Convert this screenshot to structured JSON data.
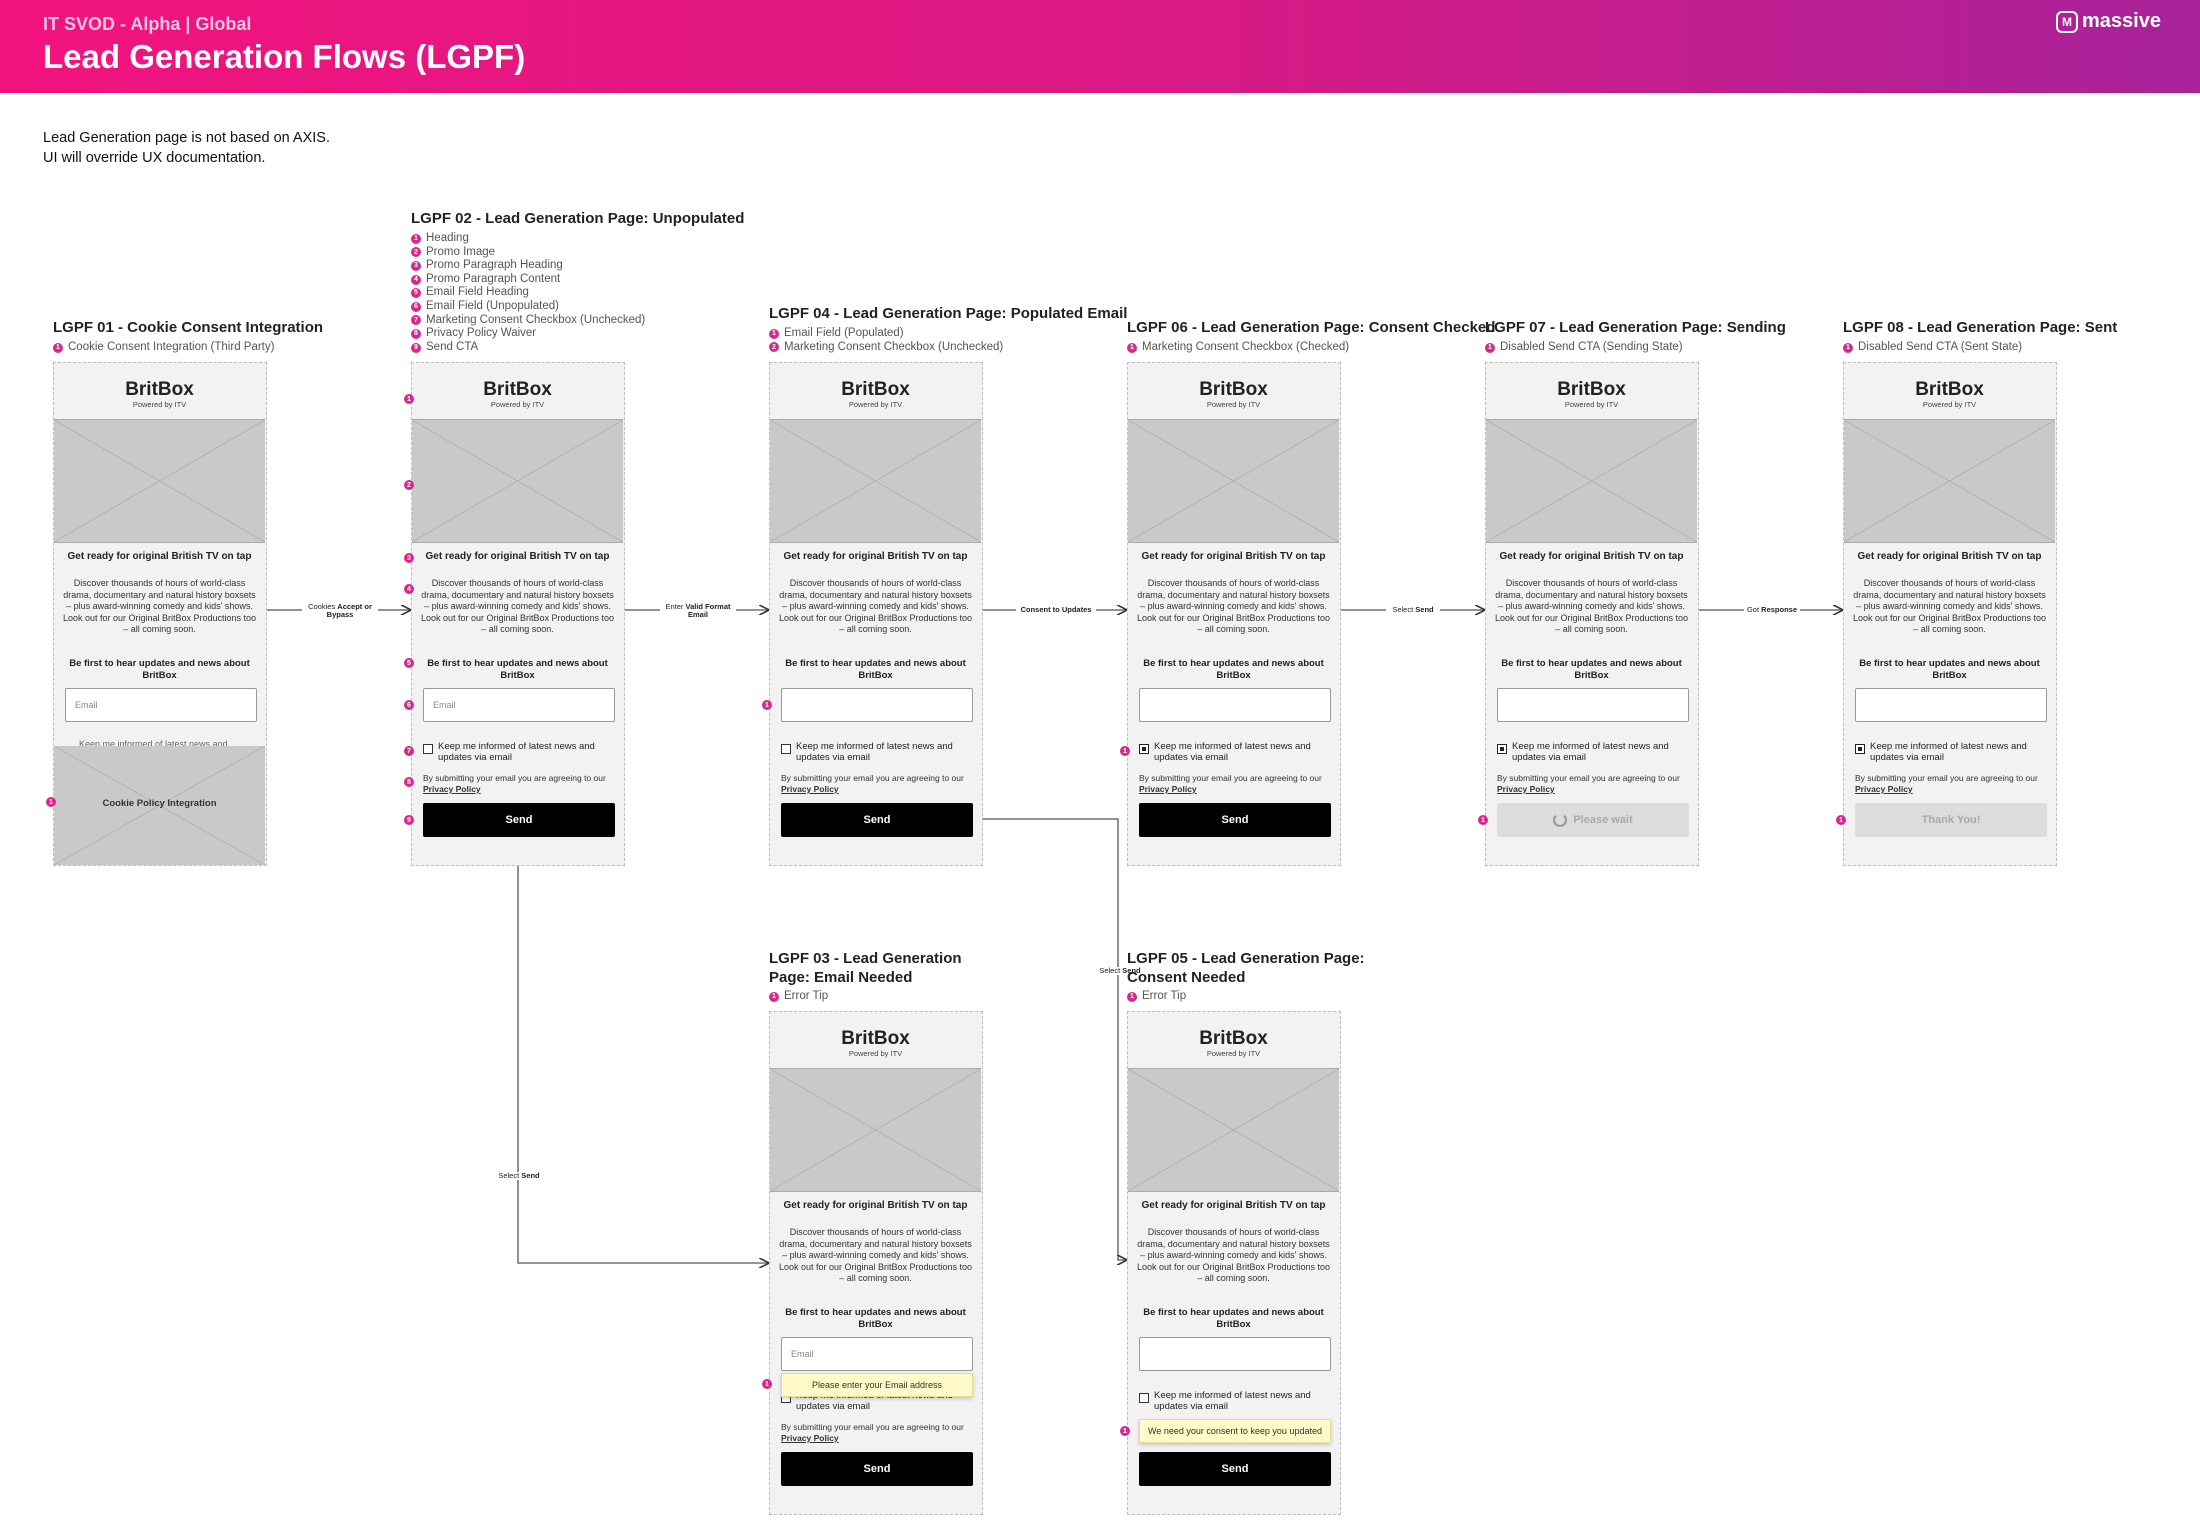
{
  "header": {
    "subtitle": "IT SVOD - Alpha | Global",
    "title": "Lead Generation Flows (LGPF)",
    "logo_text": "massive"
  },
  "notes": [
    "Lead Generation page is not based on AXIS.",
    "UI will override UX documentation."
  ],
  "brand": {
    "name": "BritBox",
    "powered": "Powered by ITV"
  },
  "content": {
    "heading": "Get ready for original British TV on tap",
    "paragraph": "Discover thousands of hours of world-class drama, documentary and natural history boxsets – plus award-winning comedy and kids' shows. Look out for our Original BritBox Productions too – all coming soon.",
    "email_heading": "Be first to hear updates and news about BritBox",
    "email_placeholder": "Email",
    "consent_label": "Keep me informed of latest news and updates via email",
    "privacy_prefix": "By submitting your email you are agreeing to our",
    "privacy_link": "Privacy Policy",
    "send": "Send",
    "please_wait": "Please wait",
    "thank_you": "Thank You!",
    "cookie_overlay": "Cookie Policy Integration",
    "cookie_ghost": "Keep me informed of latest news and",
    "error_email": "Please enter your Email address",
    "error_consent": "We need your consent to keep you updated"
  },
  "flows": {
    "f01": {
      "title": "LGPF 01 - Cookie Consent Integration",
      "annotations": [
        "Cookie Consent Integration (Third Party)"
      ]
    },
    "f02": {
      "title": "LGPF 02 - Lead Generation Page: Unpopulated",
      "annotations": [
        "Heading",
        "Promo Image",
        "Promo Paragraph Heading",
        "Promo Paragraph Content",
        "Email Field Heading",
        "Email Field (Unpopulated)",
        "Marketing Consent Checkbox (Unchecked)",
        "Privacy Policy Waiver",
        "Send CTA"
      ]
    },
    "f03": {
      "title_line1": "LGPF 03 - Lead Generation",
      "title_line2": "Page: Email Needed",
      "annotations": [
        "Error Tip"
      ]
    },
    "f04": {
      "title": "LGPF 04 - Lead Generation Page: Populated Email",
      "annotations": [
        "Email Field (Populated)",
        "Marketing Consent Checkbox (Unchecked)"
      ]
    },
    "f05": {
      "title_line1": "LGPF 05 - Lead Generation Page:",
      "title_line2": "Consent Needed",
      "annotations": [
        "Error Tip"
      ]
    },
    "f06": {
      "title": "LGPF 06 - Lead Generation Page: Consent Checked",
      "annotations": [
        "Marketing Consent Checkbox (Checked)"
      ]
    },
    "f07": {
      "title": "LGPF 07 - Lead Generation Page: Sending",
      "annotations": [
        "Disabled Send CTA (Sending State)"
      ]
    },
    "f08": {
      "title": "LGPF 08 - Lead Generation Page: Sent",
      "annotations": [
        "Disabled Send CTA (Sent State)"
      ]
    }
  },
  "arrows": {
    "a1": {
      "pre": "Cookies",
      "bold": "Accept or Bypass"
    },
    "a2": {
      "pre": "Enter",
      "bold": "Valid Format Email"
    },
    "a3": {
      "pre": "",
      "bold": "Consent to Updates"
    },
    "a4": {
      "pre": "Select",
      "bold": "Send"
    },
    "a5": {
      "pre": "Got",
      "bold": "Response"
    },
    "a6": {
      "pre": "Select",
      "bold": "Send"
    },
    "a7": {
      "pre": "Select",
      "bold": "Send"
    }
  },
  "markers": {
    "n1": "1",
    "n2": "2",
    "n3": "3",
    "n4": "4",
    "n5": "5",
    "n6": "6",
    "n7": "7",
    "n8": "8",
    "n9": "9"
  }
}
